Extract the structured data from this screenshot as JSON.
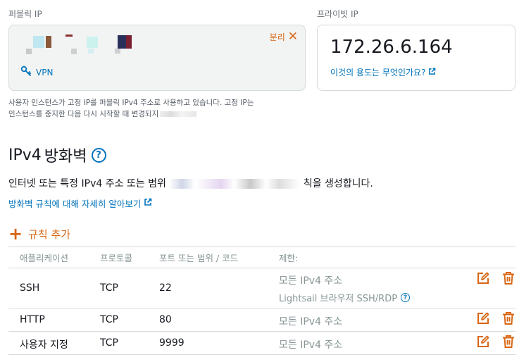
{
  "public_ip": {
    "label": "퍼블릭 IP",
    "detach_label": "분리",
    "vpn_label": "VPN"
  },
  "private_ip": {
    "label": "프라이빗 IP",
    "value": "172.26.6.164",
    "help_link": "이것의 용도는 무엇인가요?"
  },
  "note": {
    "line1": "사용자 인스턴스가 고정 IP를 퍼블릭 IPv4 주소로 사용하고 있습니다. 고정 IP는",
    "line2": "인스턴스를 중지한 다음 다시 시작할 때 변경되지"
  },
  "firewall": {
    "title_prefix": "IPv4",
    "title_main": "방화벽",
    "help_symbol": "?",
    "desc_start": "인터넷 또는 특정 IPv4 주소 또는 범위",
    "desc_end": "칙을 생성합니다.",
    "learn_more": "방화벽 규칙에 대해 자세히 알아보기",
    "add_rule": "규칙 추가",
    "columns": [
      "애플리케이션",
      "프로토콜",
      "포트 또는 범위 / 코드",
      "제한:"
    ],
    "rows": [
      {
        "application": "SSH",
        "protocol": "TCP",
        "port": "22",
        "restriction": "모든 IPv4 주소",
        "restriction_sub": "Lightsail 브라우저 SSH/RDP"
      },
      {
        "application": "HTTP",
        "protocol": "TCP",
        "port": "80",
        "restriction": "모든 IPv4 주소"
      },
      {
        "application": "사용자 지정",
        "protocol": "TCP",
        "port": "9999",
        "restriction": "모든 IPv4 주소"
      }
    ]
  },
  "colors": {
    "accent_orange": "#d86613",
    "link_blue": "#0073bb",
    "muted_text": "#879596",
    "card_bg": "#f2f3f3",
    "border": "#d5dbdb"
  },
  "icons": [
    "close-icon",
    "vpn-key-icon",
    "external-link-icon",
    "help-icon",
    "plus-icon",
    "edit-icon",
    "trash-icon"
  ]
}
